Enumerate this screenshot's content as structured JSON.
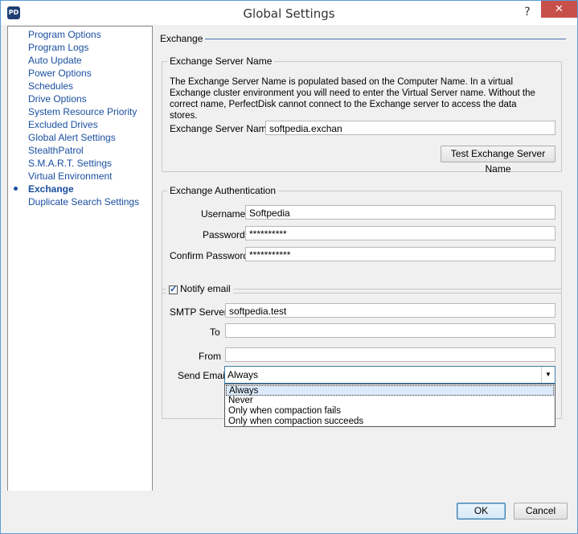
{
  "window": {
    "title": "Global Settings",
    "icon_label": "PD",
    "help_label": "?",
    "close_label": "✕"
  },
  "nav": {
    "items": [
      {
        "label": "Program Options"
      },
      {
        "label": "Program Logs"
      },
      {
        "label": "Auto Update"
      },
      {
        "label": "Power Options"
      },
      {
        "label": "Schedules"
      },
      {
        "label": "Drive Options"
      },
      {
        "label": "System Resource Priority"
      },
      {
        "label": "Excluded Drives"
      },
      {
        "label": "Global Alert Settings"
      },
      {
        "label": "StealthPatrol"
      },
      {
        "label": "S.M.A.R.T. Settings"
      },
      {
        "label": "Virtual Environment"
      },
      {
        "label": "Exchange"
      },
      {
        "label": "Duplicate Search Settings"
      }
    ],
    "active": "Exchange"
  },
  "exchange": {
    "heading": "Exchange",
    "server_group": {
      "title": "Exchange Server Name",
      "description": "The Exchange Server Name is populated based on the Computer Name. In a virtual Exchange cluster environment you will need to enter the Virtual Server name. Without the correct name, PerfectDisk cannot connect to the Exchange server to access the data stores.",
      "server_label": "Exchange Server Name",
      "server_value": "softpedia.exchan",
      "test_button": "Test Exchange Server Name"
    },
    "auth_group": {
      "title": "Exchange Authentication",
      "username_label": "Username",
      "username_value": "Softpedia",
      "password_label": "Password",
      "password_value": "**********",
      "confirm_label": "Confirm Password",
      "confirm_value": "***********"
    },
    "notify_group": {
      "title": "Notify email",
      "checked": true,
      "smtp_label": "SMTP Server",
      "smtp_value": "softpedia.test",
      "to_label": "To",
      "to_value": "",
      "from_label": "From",
      "from_value": "",
      "send_label": "Send Email",
      "send_value": "Always",
      "send_options": [
        "Always",
        "Never",
        "Only when compaction fails",
        "Only when compaction succeeds"
      ]
    }
  },
  "footer": {
    "ok_label": "OK",
    "cancel_label": "Cancel"
  }
}
